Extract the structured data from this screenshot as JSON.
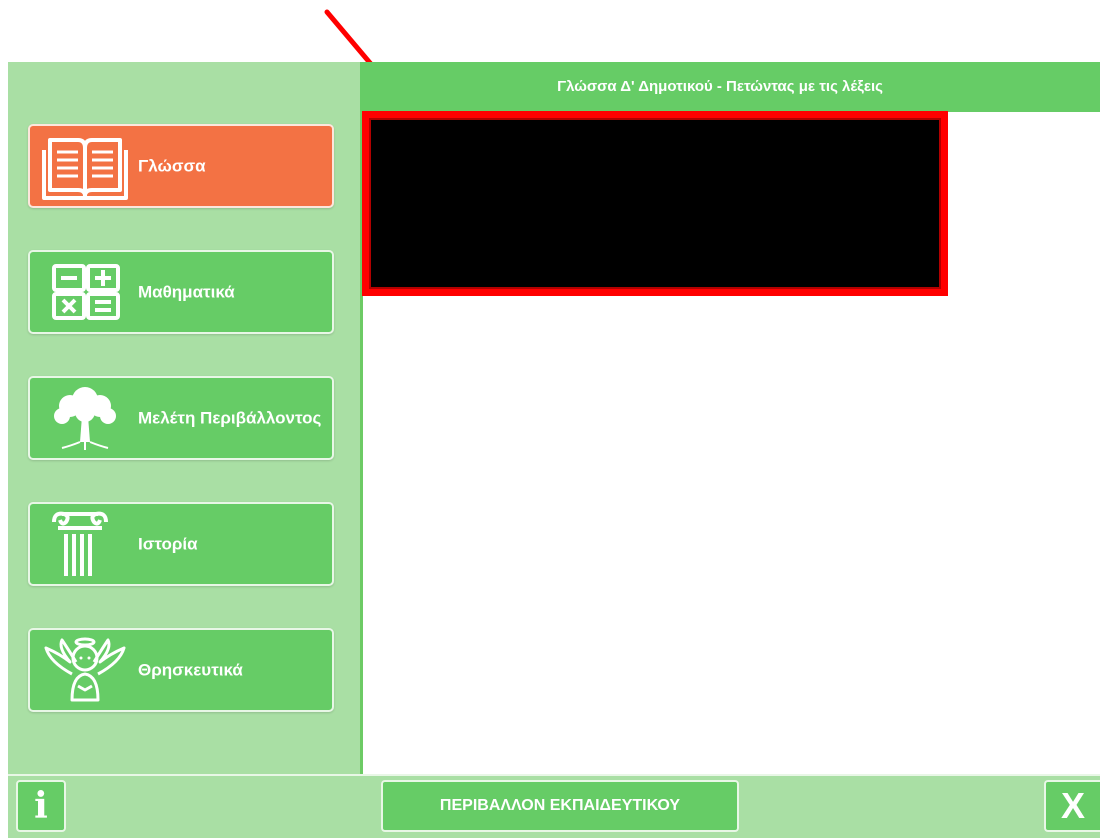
{
  "header": {
    "title": "Γλώσσα Δ' Δημοτικού - Πετώντας με τις λέξεις"
  },
  "sidebar": {
    "items": [
      {
        "label": "Γλώσσα",
        "icon": "book-icon",
        "active": true
      },
      {
        "label": "Μαθηματικά",
        "icon": "math-operators-icon",
        "active": false
      },
      {
        "label": "Μελέτη Περιβάλλοντος",
        "icon": "tree-icon",
        "active": false
      },
      {
        "label": "Ιστορία",
        "icon": "ionic-column-icon",
        "active": false
      },
      {
        "label": "Θρησκευτικά",
        "icon": "angel-icon",
        "active": false
      }
    ]
  },
  "main": {
    "video_placeholder": "black-video-area"
  },
  "footer": {
    "info_label": "i",
    "teacher_label": "ΠΕΡΙΒΑΛΛΟΝ ΕΚΠΑΙΔΕΥΤΙΚΟΥ",
    "close_label": "X"
  },
  "colors": {
    "green": "#66cc66",
    "light_green": "#a9dfa4",
    "active_orange": "#f37244",
    "annotation_red": "#ff0000"
  }
}
